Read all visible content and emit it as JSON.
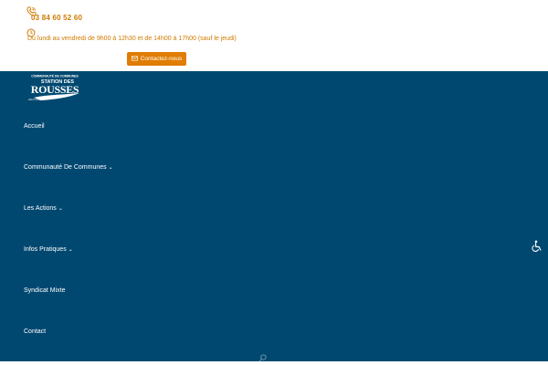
{
  "topbar": {
    "phone_icon": "phone-icon",
    "phone": "03 84 60 52 60",
    "clock_icon": "clock-icon",
    "hours": "Du lundi au vendredi de 9h00 à 12h30 et de 14h00 à 17h00 (sauf le jeudi)",
    "contact_button": {
      "icon": "envelope-icon",
      "label": "Contactez-nous"
    }
  },
  "logo": {
    "line1": "COMMUNAUTÉ DE COMMUNES",
    "line2": "STATION DES",
    "line3": "ROUSSES",
    "line4": "HAUT-JURA"
  },
  "nav": {
    "items": [
      {
        "label": "Accueil",
        "has_dropdown": false
      },
      {
        "label": "Communauté De Communes",
        "has_dropdown": true
      },
      {
        "label": "Les Actions",
        "has_dropdown": true
      },
      {
        "label": "Infos Pratiques",
        "has_dropdown": true
      },
      {
        "label": "Syndicat Mixte",
        "has_dropdown": false
      },
      {
        "label": "Contact",
        "has_dropdown": false
      }
    ],
    "dropdown_icon": "chevron-down-icon"
  },
  "icons": {
    "accessibility": "wheelchair-icon",
    "search": "search-icon"
  },
  "colors": {
    "accent": "#e07d04",
    "accent_text": "#d07a00",
    "nav_background": "#004870",
    "nav_text": "#ffffff"
  }
}
